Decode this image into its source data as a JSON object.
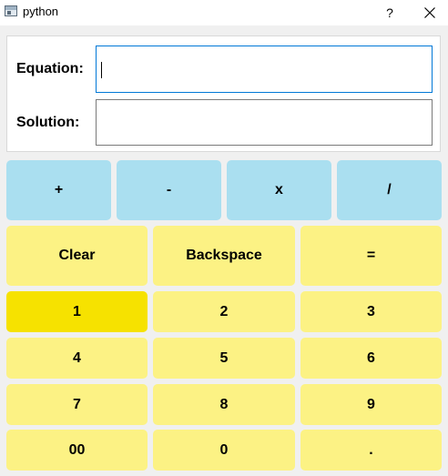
{
  "window": {
    "title": "python",
    "help_label": "?"
  },
  "form": {
    "equation_label": "Equation:",
    "equation_value": "",
    "solution_label": "Solution:",
    "solution_value": ""
  },
  "operators": {
    "add": "+",
    "subtract": "-",
    "multiply": "x",
    "divide": "/"
  },
  "actions": {
    "clear": "Clear",
    "backspace": "Backspace",
    "equals": "="
  },
  "digits": {
    "one": "1",
    "two": "2",
    "three": "3",
    "four": "4",
    "five": "5",
    "six": "6",
    "seven": "7",
    "eight": "8",
    "nine": "9",
    "double_zero": "00",
    "zero": "0",
    "decimal": "."
  },
  "colors": {
    "operator_button": "#aadff0",
    "keypad_button": "#fcf284",
    "keypad_button_active": "#f6e200",
    "input_focus_border": "#0078d7"
  }
}
